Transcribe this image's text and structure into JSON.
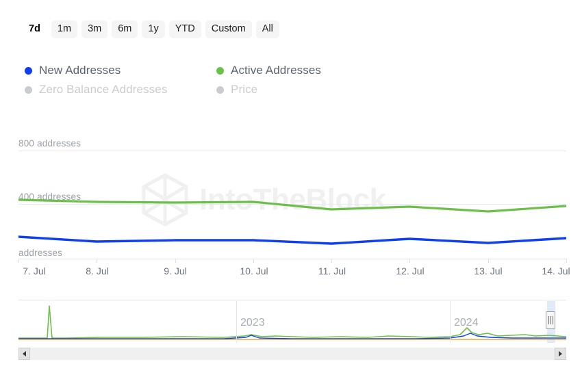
{
  "range_tabs": [
    {
      "label": "7d",
      "active": true
    },
    {
      "label": "1m",
      "active": false
    },
    {
      "label": "3m",
      "active": false
    },
    {
      "label": "6m",
      "active": false
    },
    {
      "label": "1y",
      "active": false
    },
    {
      "label": "YTD",
      "active": false
    },
    {
      "label": "Custom",
      "active": false
    },
    {
      "label": "All",
      "active": false
    }
  ],
  "legend": [
    {
      "label": "New Addresses",
      "color": "#0d3ef0",
      "enabled": true
    },
    {
      "label": "Active Addresses",
      "color": "#6cc04a",
      "enabled": true
    },
    {
      "label": "Zero Balance Addresses",
      "color": "#c9ccd1",
      "enabled": false
    },
    {
      "label": "Price",
      "color": "#c9ccd1",
      "enabled": false
    }
  ],
  "watermark": {
    "text": "IntoTheBlock",
    "logo": "hexagon-cube-icon",
    "color": "#f0f0f1"
  },
  "navigator": {
    "years": [
      "2023",
      "2024"
    ],
    "handle_icon": "grip-handle-icon",
    "scroll_left_icon": "arrow-left-icon",
    "scroll_right_icon": "arrow-right-icon"
  },
  "chart_data": {
    "type": "line",
    "title": "",
    "xlabel": "",
    "ylabel": "addresses",
    "grid": true,
    "legend_position": "top-left",
    "ylim": [
      0,
      900
    ],
    "yticks": [
      0,
      400,
      800
    ],
    "ytick_labels": [
      "addresses",
      "400 addresses",
      "800 addresses"
    ],
    "categories": [
      "7. Jul",
      "8. Jul",
      "9. Jul",
      "10. Jul",
      "11. Jul",
      "12. Jul",
      "13. Jul",
      "14. Jul"
    ],
    "series": [
      {
        "name": "New Addresses",
        "color": "#0d3ef0",
        "values": [
          152,
          120,
          128,
          131,
          104,
          136,
          110,
          140
        ]
      },
      {
        "name": "Active Addresses",
        "color": "#6cc04a",
        "values": [
          412,
          398,
          392,
          398,
          345,
          362,
          330,
          368
        ]
      },
      {
        "name": "Zero Balance Addresses",
        "color": "#c9ccd1",
        "values": [],
        "enabled": false
      },
      {
        "name": "Price",
        "color": "#c9ccd1",
        "values": [],
        "enabled": false
      }
    ]
  }
}
